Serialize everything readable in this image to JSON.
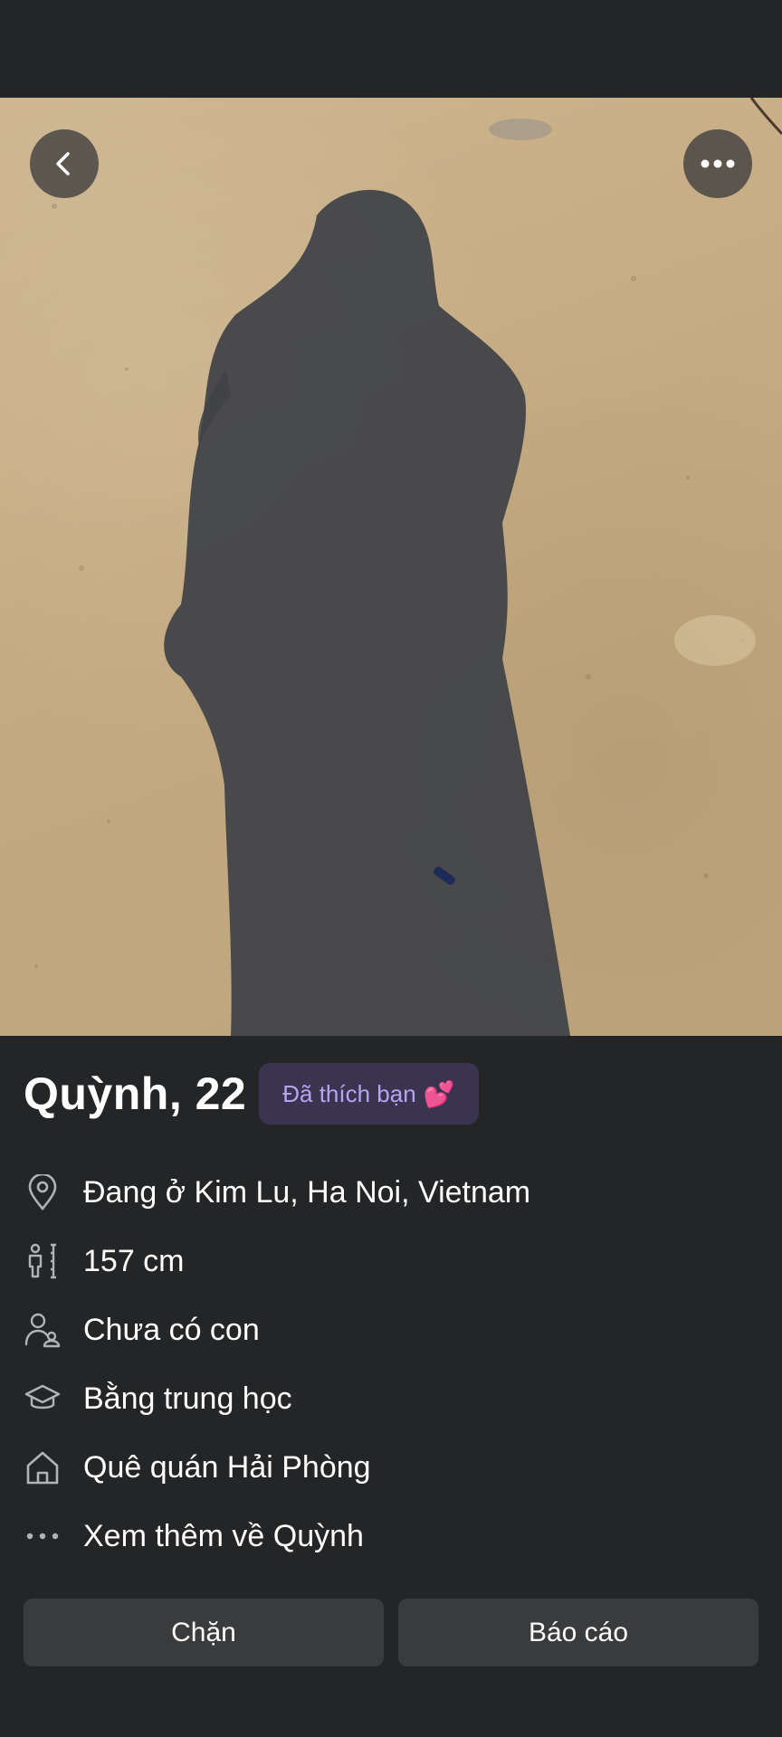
{
  "profile": {
    "name_age": "Quỳnh, 22",
    "liked_badge": "Đã thích bạn",
    "liked_emoji": "💕"
  },
  "info": [
    {
      "icon": "location-pin-icon",
      "text": "Đang ở Kim Lu, Ha Noi, Vietnam"
    },
    {
      "icon": "height-icon",
      "text": "157 cm"
    },
    {
      "icon": "children-icon",
      "text": "Chưa có con"
    },
    {
      "icon": "education-cap-icon",
      "text": "Bằng trung học"
    },
    {
      "icon": "hometown-house-icon",
      "text": "Quê quán Hải Phòng"
    },
    {
      "icon": "more-dots-icon",
      "text": "Xem thêm về Quỳnh"
    }
  ],
  "actions": {
    "block_label": "Chặn",
    "report_label": "Báo cáo"
  },
  "colors": {
    "background": "#242526",
    "badge_bg": "#3b3450",
    "badge_text": "#b9a3f0",
    "button_bg": "#3a3b3c"
  }
}
